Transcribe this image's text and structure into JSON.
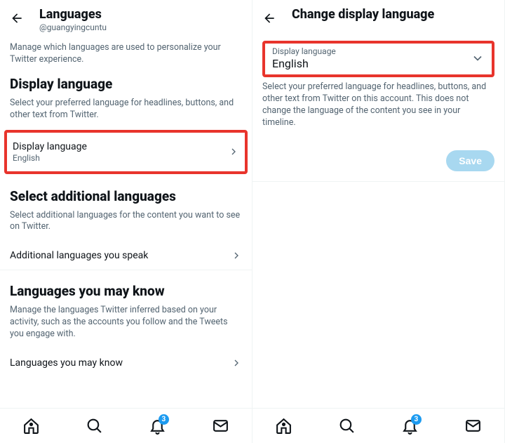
{
  "left": {
    "title": "Languages",
    "username": "@guangyingcuntu",
    "intro": "Manage which languages are used to personalize your Twitter experience.",
    "display_title": "Display language",
    "display_desc": "Select your preferred language for headlines, buttons, and other text from Twitter.",
    "display_item_title": "Display language",
    "display_item_value": "English",
    "additional_title": "Select additional languages",
    "additional_desc": "Select additional languages for the content you want to see on Twitter.",
    "additional_item_title": "Additional languages you speak",
    "mayknow_title": "Languages you may know",
    "mayknow_desc": "Manage the languages Twitter inferred based on your activity, such as the accounts you follow and the Tweets you engage with.",
    "mayknow_item_title": "Languages you may know"
  },
  "right": {
    "title": "Change display language",
    "dropdown_label": "Display language",
    "dropdown_value": "English",
    "desc": "Select your preferred language for headlines, buttons, and other text from Twitter on this account. This does not change the language of the content you see in your timeline.",
    "save_label": "Save"
  },
  "nav": {
    "badge_count": "3"
  }
}
